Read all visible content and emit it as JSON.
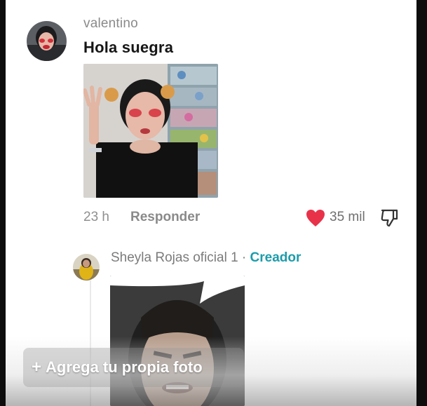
{
  "comment": {
    "username": "valentino",
    "text": "Hola suegra",
    "time": "23 h",
    "reply_label": "Responder",
    "likes": "35 mil",
    "icons": [
      "heart-icon",
      "dislike-icon"
    ],
    "like_color": "#e8324a"
  },
  "reply": {
    "username": "Sheyla Rojas oficial 1",
    "separator": " · ",
    "badge": "Creador",
    "badge_color": "#1c9cab"
  },
  "composer": {
    "plus": "+",
    "add_photo_label": "Agrega tu propia foto"
  }
}
